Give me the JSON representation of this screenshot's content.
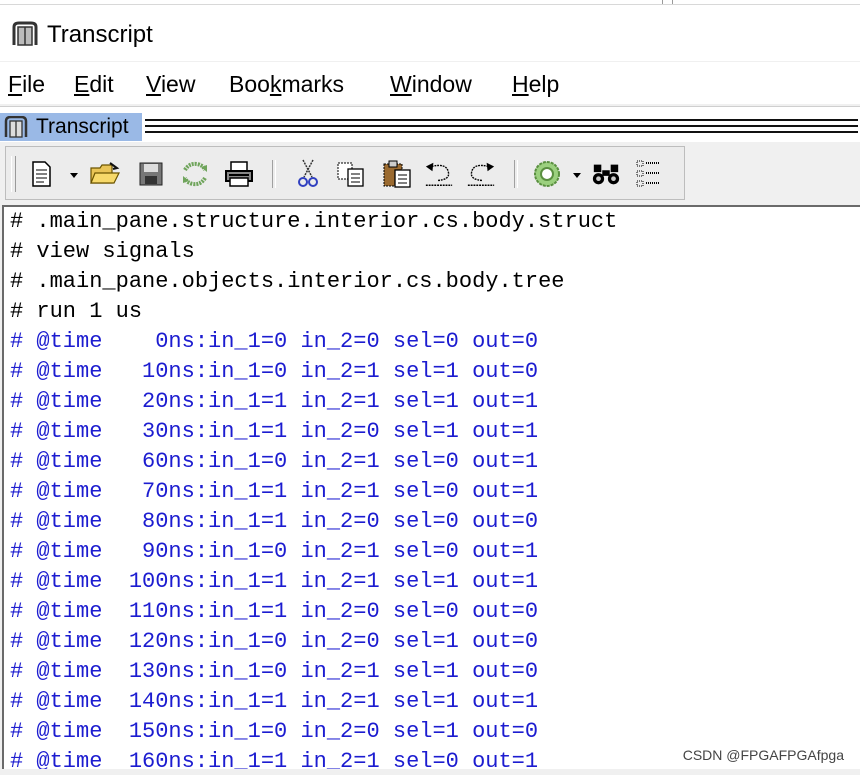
{
  "window": {
    "title": "Transcript",
    "icon": "transcript-book-icon"
  },
  "menu": [
    {
      "label": "File",
      "mnemonic": "F"
    },
    {
      "label": "Edit",
      "mnemonic": "E"
    },
    {
      "label": "View",
      "mnemonic": "V"
    },
    {
      "label": "Bookmarks",
      "mnemonic": "k"
    },
    {
      "label": "Window",
      "mnemonic": "W"
    },
    {
      "label": "Help",
      "mnemonic": "H"
    }
  ],
  "pane": {
    "title": "Transcript",
    "icon": "transcript-book-icon"
  },
  "toolbar": {
    "buttons": [
      "new-document-icon",
      "open-folder-icon",
      "save-icon",
      "reload-icon",
      "print-icon",
      "cut-icon",
      "copy-icon",
      "paste-icon",
      "undo-icon",
      "redo-icon",
      "compile-icon",
      "find-icon",
      "format-icon"
    ]
  },
  "transcript": {
    "lines": [
      {
        "text": "# .main_pane.structure.interior.cs.body.struct",
        "kind": "cmd"
      },
      {
        "text": "# view signals",
        "kind": "cmd"
      },
      {
        "text": "# .main_pane.objects.interior.cs.body.tree",
        "kind": "cmd"
      },
      {
        "text": "# run 1 us",
        "kind": "cmd"
      },
      {
        "text": "# @time    0ns:in_1=0 in_2=0 sel=0 out=0",
        "kind": "out"
      },
      {
        "text": "# @time   10ns:in_1=0 in_2=1 sel=1 out=0",
        "kind": "out"
      },
      {
        "text": "# @time   20ns:in_1=1 in_2=1 sel=1 out=1",
        "kind": "out"
      },
      {
        "text": "# @time   30ns:in_1=1 in_2=0 sel=1 out=1",
        "kind": "out"
      },
      {
        "text": "# @time   60ns:in_1=0 in_2=1 sel=0 out=1",
        "kind": "out"
      },
      {
        "text": "# @time   70ns:in_1=1 in_2=1 sel=0 out=1",
        "kind": "out"
      },
      {
        "text": "# @time   80ns:in_1=1 in_2=0 sel=0 out=0",
        "kind": "out"
      },
      {
        "text": "# @time   90ns:in_1=0 in_2=1 sel=0 out=1",
        "kind": "out"
      },
      {
        "text": "# @time  100ns:in_1=1 in_2=1 sel=1 out=1",
        "kind": "out"
      },
      {
        "text": "# @time  110ns:in_1=1 in_2=0 sel=0 out=0",
        "kind": "out"
      },
      {
        "text": "# @time  120ns:in_1=0 in_2=0 sel=1 out=0",
        "kind": "out"
      },
      {
        "text": "# @time  130ns:in_1=0 in_2=1 sel=1 out=0",
        "kind": "out"
      },
      {
        "text": "# @time  140ns:in_1=1 in_2=1 sel=1 out=1",
        "kind": "out"
      },
      {
        "text": "# @time  150ns:in_1=0 in_2=0 sel=1 out=0",
        "kind": "out"
      },
      {
        "text": "# @time  160ns:in_1=1 in_2=1 sel=0 out=1",
        "kind": "out"
      }
    ]
  },
  "watermark": "CSDN @FPGAFPGAfpga",
  "colors": {
    "command_text": "#000000",
    "output_text": "#1c1cd0",
    "pane_tab": "#9ab9e6"
  }
}
